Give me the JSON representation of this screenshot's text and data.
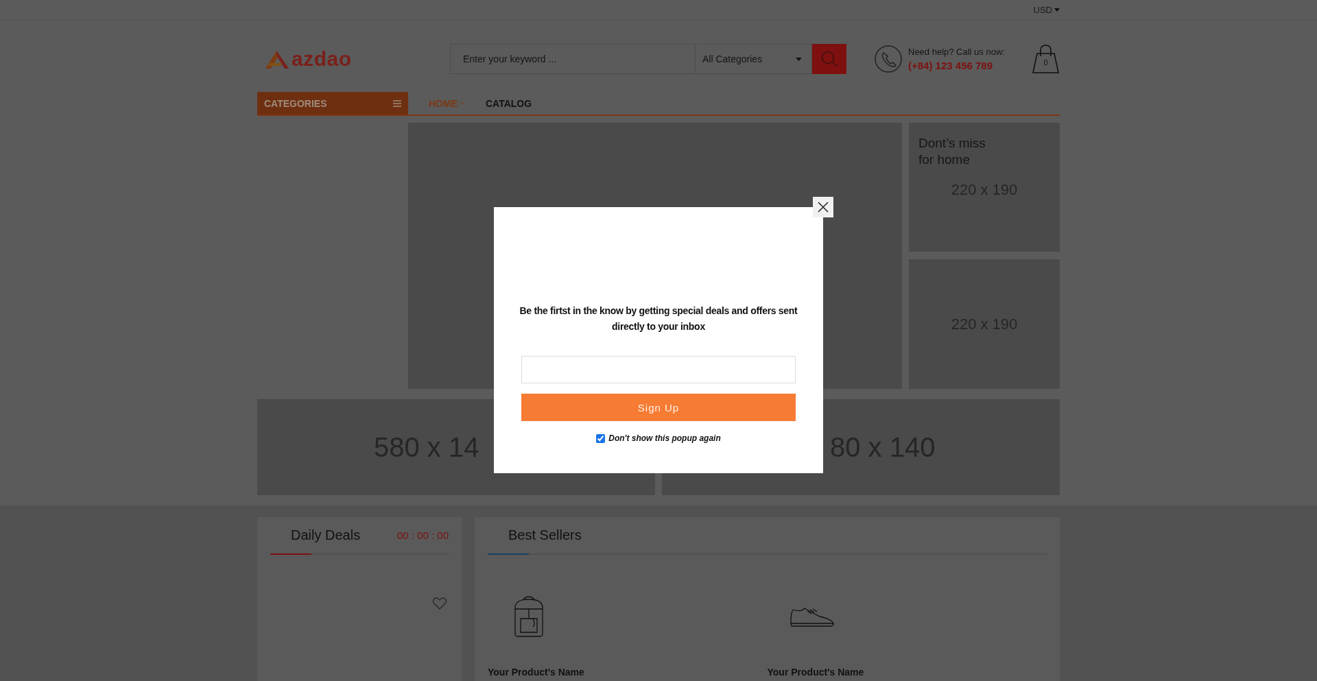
{
  "top_bar": {
    "currency": "USD"
  },
  "header": {
    "logo": "azdao",
    "search": {
      "placeholder": "Enter your keyword ...",
      "category": "All Categories"
    },
    "help": {
      "label": "Need help? Call us now:",
      "phone": "(+84) 123 456 789"
    },
    "cart": {
      "count": "0"
    }
  },
  "nav": {
    "categories_label": "CATEGORIES",
    "items": [
      {
        "label": "HOME",
        "selected": true,
        "has_dropdown": true
      },
      {
        "label": "CATALOG",
        "selected": false,
        "has_dropdown": false
      }
    ]
  },
  "side_banners": [
    {
      "title": "Dont’s miss\nfor home",
      "size": "220 x 190"
    },
    {
      "size": "220 x 190"
    }
  ],
  "wide_banners": [
    {
      "size": "580 x 14"
    },
    {
      "size": "80 x 140"
    }
  ],
  "daily_deals": {
    "title": "Daily Deals",
    "timer": "00 : 00 : 00"
  },
  "best_sellers": {
    "title": "Best Sellers",
    "products": [
      {
        "kind": "backpack",
        "name": "Your Product's Name"
      },
      {
        "kind": "sneaker",
        "name": "Your Product's Name"
      }
    ]
  },
  "popup": {
    "message": "Be the firtst in the know by getting special deals and offers sent directly to your inbox",
    "button": "Sign Up",
    "dont_show_again": {
      "label": "Don't show this popup again",
      "checked": true
    }
  }
}
